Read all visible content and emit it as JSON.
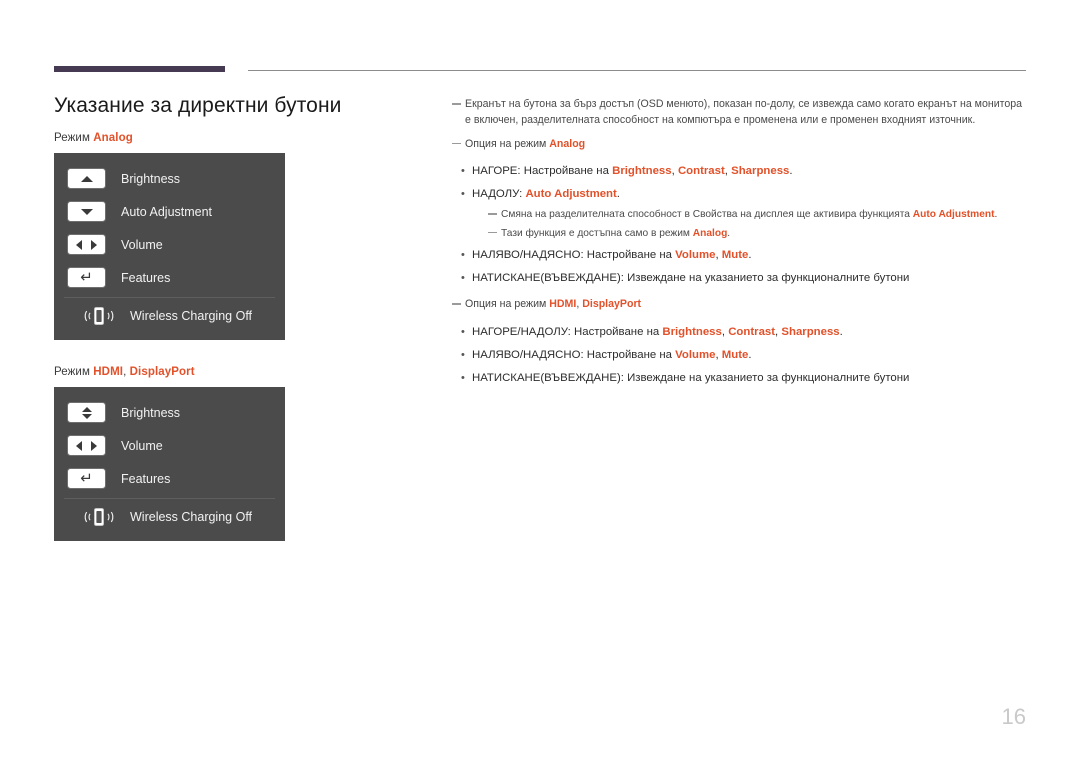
{
  "page": {
    "title": "Указание за директни бутони",
    "number": "16",
    "accent_color": "#e2512a",
    "rule_color": "#453a52",
    "osd_bg_color": "#4b4b4b"
  },
  "left": {
    "mode1": {
      "prefix": "Режим",
      "values": [
        "Analog"
      ]
    },
    "mode2": {
      "prefix": "Режим",
      "values": [
        "HDMI",
        "DisplayPort"
      ]
    },
    "osd_analog": {
      "rows": [
        {
          "icon": "arrow-up-icon",
          "label": "Brightness"
        },
        {
          "icon": "arrow-down-icon",
          "label": "Auto Adjustment"
        },
        {
          "icon": "arrow-left-right-icon",
          "label": "Volume"
        },
        {
          "icon": "enter-arrow-icon",
          "label": "Features"
        }
      ],
      "wireless": {
        "icon": "wireless-charging-icon",
        "label": "Wireless Charging Off"
      }
    },
    "osd_digital": {
      "rows": [
        {
          "icon": "arrow-up-down-icon",
          "label": "Brightness"
        },
        {
          "icon": "arrow-left-right-icon",
          "label": "Volume"
        },
        {
          "icon": "enter-arrow-icon",
          "label": "Features"
        }
      ],
      "wireless": {
        "icon": "wireless-charging-icon",
        "label": "Wireless Charging Off"
      }
    }
  },
  "right": {
    "intro_note": "Екранът на бутона за бърз достъп (OSD менюто), показан по-долу, се извежда само когато екранът на монитора е включен, разделителната способност на компютъра е променена или е променен входният източник.",
    "section_analog": {
      "heading_prefix": "Опция на режим",
      "heading_values": [
        "Analog"
      ],
      "bullets": [
        {
          "marker": "•",
          "prefix": "НАГОРЕ: Настройване на ",
          "highlights": [
            "Brightness",
            "Contrast",
            "Sharpness"
          ],
          "suffix": "."
        },
        {
          "marker": "•",
          "prefix": "НАДОЛУ: ",
          "highlights": [
            "Auto Adjustment"
          ],
          "suffix": ".",
          "subnotes": [
            {
              "prefix": "Смяна на разделителната способност в Свойства на дисплея ще активира функцията ",
              "highlights": [
                "Auto Adjustment"
              ],
              "suffix": "."
            },
            {
              "prefix": "Тази функция е достъпна само в режим ",
              "highlights": [
                "Analog"
              ],
              "suffix": "."
            }
          ]
        },
        {
          "marker": "•",
          "prefix": "НАЛЯВО/НАДЯСНО: Настройване на ",
          "highlights": [
            "Volume",
            "Mute"
          ],
          "suffix": "."
        },
        {
          "marker": "•",
          "prefix": "НАТИСКАНЕ(ВЪВЕЖДАНЕ): Извеждане на указанието за функционалните бутони",
          "highlights": [],
          "suffix": ""
        }
      ]
    },
    "section_digital": {
      "heading_prefix": "Опция на режим",
      "heading_values": [
        "HDMI",
        "DisplayPort"
      ],
      "bullets": [
        {
          "marker": "•",
          "prefix": "НАГОРЕ/НАДОЛУ: Настройване на ",
          "highlights": [
            "Brightness",
            "Contrast",
            "Sharpness"
          ],
          "suffix": "."
        },
        {
          "marker": "•",
          "prefix": "НАЛЯВО/НАДЯСНО: Настройване на ",
          "highlights": [
            "Volume",
            "Mute"
          ],
          "suffix": "."
        },
        {
          "marker": "•",
          "prefix": "НАТИСКАНЕ(ВЪВЕЖДАНЕ): Извеждане на указанието за функционалните бутони",
          "highlights": [],
          "suffix": ""
        }
      ]
    }
  }
}
